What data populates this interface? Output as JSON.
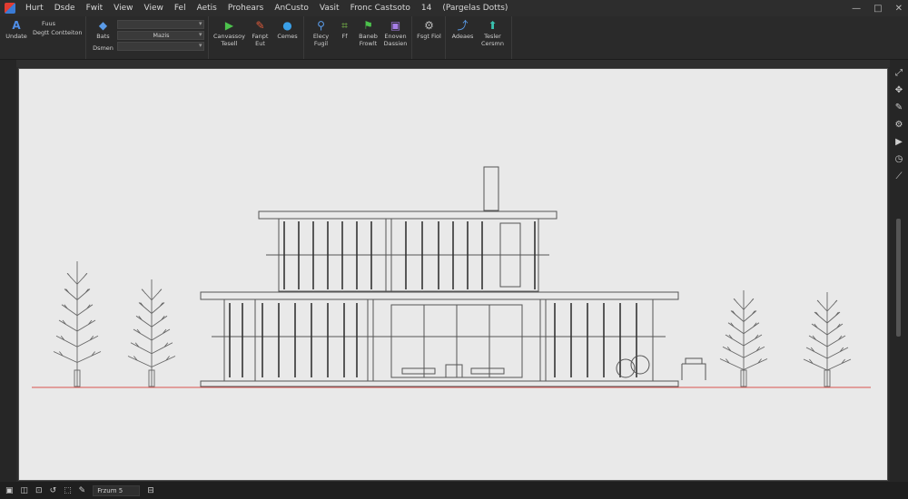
{
  "menu": {
    "items": [
      "Hurt",
      "Dsde",
      "Fwit",
      "View",
      "View",
      "Fel",
      "Aetis",
      "Prohears",
      "AnCusto",
      "Vasit",
      "Fronc Castsoto",
      "14",
      "(Pargelas Dotts)"
    ]
  },
  "window_controls": {
    "minimize": "—",
    "maximize": "□",
    "close": "✕"
  },
  "ribbon": {
    "group1": {
      "label": "Undate",
      "stack": [
        "Fuus",
        "Degtt Contteiton"
      ]
    },
    "group2": {
      "top": "Bats",
      "bottom": "Dsmen",
      "dropdowns": [
        "",
        "Mazis",
        ""
      ]
    },
    "group3": [
      {
        "icon": "play-icon",
        "label": "Canvassoy Tesell"
      },
      {
        "icon": "pencil-icon",
        "label": "Fanpt Eut"
      },
      {
        "icon": "shape-icon",
        "label": "Cemes"
      }
    ],
    "group4": [
      {
        "icon": "search-icon",
        "label": "Elecy Fugil"
      },
      {
        "icon": "crop-icon",
        "label": "Ff"
      },
      {
        "icon": "flag-icon",
        "label": "Baneb Frowlt"
      },
      {
        "icon": "image-icon",
        "label": "Enoven Dassien"
      }
    ],
    "group5": [
      {
        "icon": "settings-icon",
        "label": "Fsgt Fiol"
      }
    ],
    "group6": [
      {
        "icon": "adjust-icon",
        "label": "Adeaes"
      },
      {
        "icon": "person-icon",
        "label": "Tesler Cersmn"
      }
    ]
  },
  "statusbar": {
    "field": "Frzum 5"
  },
  "colors": {
    "accent_red": "#e03c31",
    "accent_blue": "#3a7bd5",
    "ground_line": "#d9534f",
    "drawing_line": "#555555"
  }
}
